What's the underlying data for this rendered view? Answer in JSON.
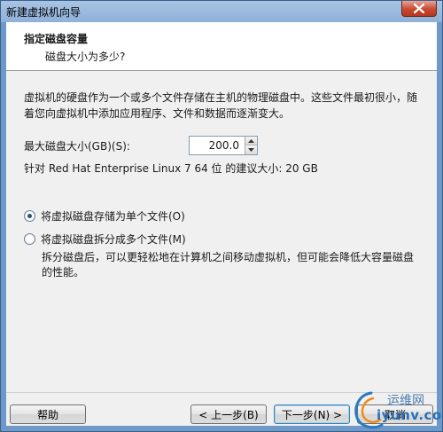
{
  "window": {
    "title": "新建虚拟机向导"
  },
  "header": {
    "title": "指定磁盘容量",
    "subtitle": "磁盘大小为多少?"
  },
  "content": {
    "description": "虚拟机的硬盘作为一个或多个文件存储在主机的物理磁盘中。这些文件最初很小，随着您向虚拟机中添加应用程序、文件和数据而逐渐变大。",
    "max_size_label": "最大磁盘大小(GB)(S):",
    "max_size_value": "200.0",
    "recommend_text": "针对 Red Hat Enterprise Linux 7 64 位 的建议大小: 20 GB",
    "options": [
      {
        "label": "将虚拟磁盘存储为单个文件(O)",
        "checked": true
      },
      {
        "label": "将虚拟磁盘拆分成多个文件(M)",
        "checked": false
      }
    ],
    "split_note": "拆分磁盘后，可以更轻松地在计算机之间移动虚拟机，但可能会降低大容量磁盘的性能。"
  },
  "buttons": {
    "help": "帮助",
    "back": "< 上一步(B)",
    "next": "下一步(N) >",
    "cancel": "取消"
  },
  "watermark": {
    "line1": "运维网",
    "line2": "iyunv.com"
  },
  "colors": {
    "titlebar": "#8eb0d8",
    "close_button": "#c74a31",
    "dialog_bg": "#f0f0f0"
  }
}
